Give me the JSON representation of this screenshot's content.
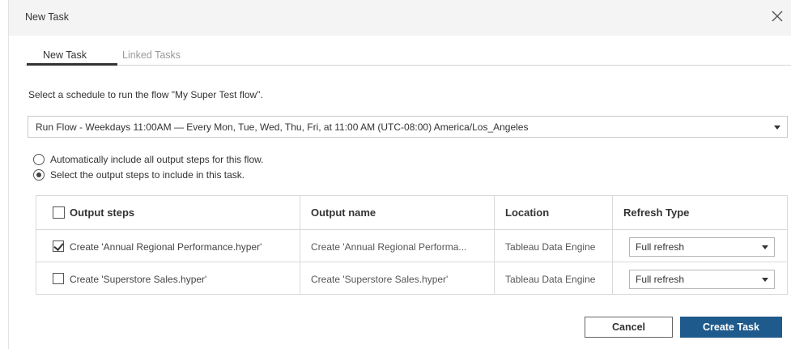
{
  "dialog": {
    "title": "New Task",
    "close_icon": "close-icon"
  },
  "tabs": [
    {
      "label": "New Task",
      "active": true
    },
    {
      "label": "Linked Tasks",
      "active": false
    }
  ],
  "instruction": "Select a schedule to run the flow \"My Super Test flow\".",
  "schedule": {
    "selected": "Run Flow - Weekdays 11:00AM — Every Mon, Tue, Wed, Thu, Fri, at 11:00 AM (UTC-08:00) America/Los_Angeles"
  },
  "output_options": [
    {
      "label": "Automatically include all output steps for this flow.",
      "selected": false
    },
    {
      "label": "Select the output steps to include in this task.",
      "selected": true
    }
  ],
  "table": {
    "headers": [
      "Output steps",
      "Output name",
      "Location",
      "Refresh Type"
    ],
    "rows": [
      {
        "step": "Create 'Annual Regional Performance.hyper'",
        "name": "Create 'Annual Regional Performa...",
        "location": "Tableau Data Engine",
        "refresh": "Full refresh",
        "checked": true
      },
      {
        "step": "Create 'Superstore Sales.hyper'",
        "name": "Create 'Superstore Sales.hyper'",
        "location": "Tableau Data Engine",
        "refresh": "Full refresh",
        "checked": false
      }
    ]
  },
  "buttons": {
    "cancel": "Cancel",
    "create": "Create Task"
  },
  "colors": {
    "primary": "#1f5a8c",
    "header_bg": "#f4f4f4",
    "border": "#d9d9d9"
  }
}
